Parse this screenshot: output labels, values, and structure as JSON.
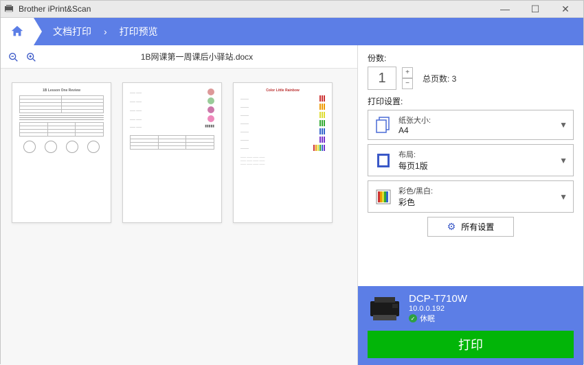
{
  "titlebar": {
    "app_title": "Brother iPrint&Scan"
  },
  "breadcrumb": {
    "item1": "文档打印",
    "item2": "打印预览"
  },
  "document": {
    "filename": "1B网课第一周课后小驿站.docx"
  },
  "copies": {
    "label": "份数:",
    "value": "1",
    "total_label": "总页数: 3"
  },
  "print_settings_label": "打印设置:",
  "options": {
    "paper": {
      "label": "纸张大小:",
      "value": "A4"
    },
    "layout": {
      "label": "布局:",
      "value": "每页1版"
    },
    "color": {
      "label": "彩色/黑白:",
      "value": "彩色"
    }
  },
  "all_settings": "所有设置",
  "printer": {
    "name": "DCP-T710W",
    "ip": "10.0.0.192",
    "status": "休眠"
  },
  "print_button": "打印"
}
